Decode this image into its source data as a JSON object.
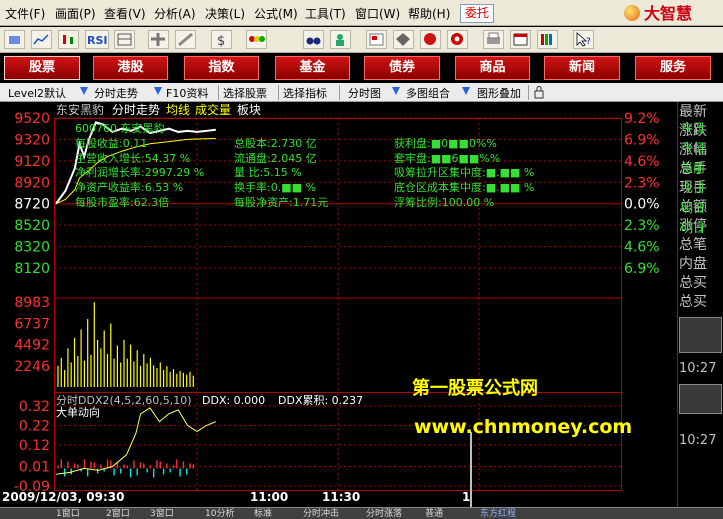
{
  "menu": [
    "文件(F)",
    "画面(P)",
    "查看(V)",
    "分析(A)",
    "决策(L)",
    "公式(M)",
    "工具(T)",
    "窗口(W)",
    "帮助(H)"
  ],
  "entrust_label": "委托",
  "logo_text": "大智慧",
  "nav": [
    "股票",
    "港股",
    "指数",
    "基金",
    "债券",
    "商品",
    "新闻",
    "服务"
  ],
  "subbar": {
    "level2": "Level2默认",
    "fenshi": "分时走势",
    "f10": "F10资料",
    "select_stock": "选择股票",
    "select_indicator": "选择指标",
    "fenshitu": "分时图",
    "multi": "多图组合",
    "overlay": "图形叠加"
  },
  "chart_header": {
    "name": "东安黑豹",
    "view": "分时走势",
    "avg_label": "均线",
    "vol_label": "成交量",
    "sector_label": "板块"
  },
  "stock_box": {
    "code_name": "600760 东安黑豹",
    "eps": "每股收益:0.11",
    "rev_growth": "主营收入增长:54.37 %",
    "profit_growth": "净利润增长率:2997.29 %",
    "nav_yield": "净资产收益率:6.53 %",
    "pe": "每股市盈率:62.3倍",
    "total_shares": "总股本:2.730 亿",
    "float_shares": "流通盘:2.045 亿",
    "vol_ratio": "量  比:5.15 %",
    "turnover": "换手率:0.■■ %",
    "nav_per_share": "每股净资产:1.71元",
    "profit_plate": "获利盘:■0■■0%%",
    "trapped": "套牢盘:■■6■■%%",
    "absorb": "吸筹拉升区集中度:■.■■ %",
    "bottom_cost": "底仓区成本集中度:■.■■ %",
    "float_ratio": "浮筹比例:100.00 %"
  },
  "price_ticks_left": [
    "9520",
    "9320",
    "9120",
    "8920",
    "8720",
    "8520",
    "8320",
    "8120"
  ],
  "price_ticks_right": [
    "9.2%",
    "6.9%",
    "4.6%",
    "2.3%",
    "0.0%",
    "2.3%",
    "4.6%",
    "6.9%"
  ],
  "volume_ticks": [
    "8983",
    "6737",
    "4492",
    "2246"
  ],
  "ddx_header": {
    "title": "分时DDX2(4,5,2,60,5,10)",
    "ddx": "DDX: 0.000",
    "ddx_cum": "DDX累积: 0.237",
    "sub": "大单动向"
  },
  "ddx_ticks": [
    "0.32",
    "0.22",
    "0.12",
    "0.01",
    "-0.09"
  ],
  "watermark": {
    "line1": "第一股票公式网",
    "line2": "www.chnmoney.com"
  },
  "time_labels": {
    "start": "2009/12/03, 09:30",
    "t1100": "11:00",
    "t1130": "11:30",
    "t1": "1"
  },
  "right_panel": [
    "最新",
    "涨跌",
    "涨幅",
    "总手",
    "现手",
    "总额",
    "涨停",
    "总笔",
    "内盘",
    "总买",
    "总买"
  ],
  "right_panel_overlay": [
    "今日",
    "今日",
    "当前",
    "今日",
    "明日",
    "明日"
  ],
  "right_panel_time": "10:27",
  "status": [
    "1窗口",
    "2窗口",
    "3窗口",
    "10分析",
    "标准",
    "分时冲击",
    "分时涨落",
    "普通",
    "东方红程"
  ],
  "chart_data": {
    "type": "line",
    "title": "东安黑豹 分时走势",
    "price_line": [
      [
        0,
        8720
      ],
      [
        4,
        8840
      ],
      [
        8,
        9050
      ],
      [
        10,
        9280
      ],
      [
        12,
        9160
      ],
      [
        14,
        9320
      ],
      [
        17,
        9480
      ],
      [
        20,
        9460
      ],
      [
        24,
        9390
      ],
      [
        28,
        9420
      ],
      [
        32,
        9400
      ],
      [
        36,
        9440
      ],
      [
        40,
        9380
      ],
      [
        44,
        9400
      ],
      [
        48,
        9420
      ],
      [
        52,
        9390
      ],
      [
        56,
        9400
      ],
      [
        60,
        9390
      ],
      [
        64,
        9400
      ],
      [
        68,
        9410
      ]
    ],
    "avg_line": [
      [
        0,
        8720
      ],
      [
        4,
        8760
      ],
      [
        8,
        8850
      ],
      [
        10,
        8960
      ],
      [
        14,
        9030
      ],
      [
        18,
        9110
      ],
      [
        22,
        9160
      ],
      [
        28,
        9210
      ],
      [
        34,
        9250
      ],
      [
        40,
        9280
      ],
      [
        48,
        9300
      ],
      [
        56,
        9320
      ],
      [
        68,
        9330
      ]
    ],
    "volume_bars": [
      2246,
      3100,
      1800,
      4100,
      2600,
      5200,
      3300,
      6100,
      2800,
      7200,
      3400,
      8983,
      5000,
      4100,
      6000,
      3500,
      6737,
      3000,
      4400,
      2600,
      5000,
      3000,
      4492,
      2700,
      3900,
      2246,
      3500,
      2500,
      3100,
      2300,
      2000,
      2600,
      1800,
      2200,
      1600,
      1900,
      1400,
      1700,
      1500,
      1300,
      1600,
      1200
    ],
    "ddx_line": [
      [
        0,
        -0.03
      ],
      [
        6,
        -0.02
      ],
      [
        12,
        0.0
      ],
      [
        18,
        -0.01
      ],
      [
        24,
        0.01
      ],
      [
        30,
        0.07
      ],
      [
        34,
        0.18
      ],
      [
        36,
        0.28
      ],
      [
        40,
        0.31
      ],
      [
        44,
        0.24
      ],
      [
        48,
        0.28
      ],
      [
        52,
        0.3
      ],
      [
        56,
        0.22
      ],
      [
        60,
        0.19
      ],
      [
        64,
        0.22
      ],
      [
        68,
        0.24
      ]
    ],
    "ylim_price": [
      8120,
      9520
    ],
    "ylim_ddx": [
      -0.09,
      0.32
    ]
  },
  "colors": {
    "up": "#ff3030",
    "down": "#00e5e5",
    "green": "#33e033",
    "yellow": "#ffff00",
    "grid": "#b00000"
  }
}
